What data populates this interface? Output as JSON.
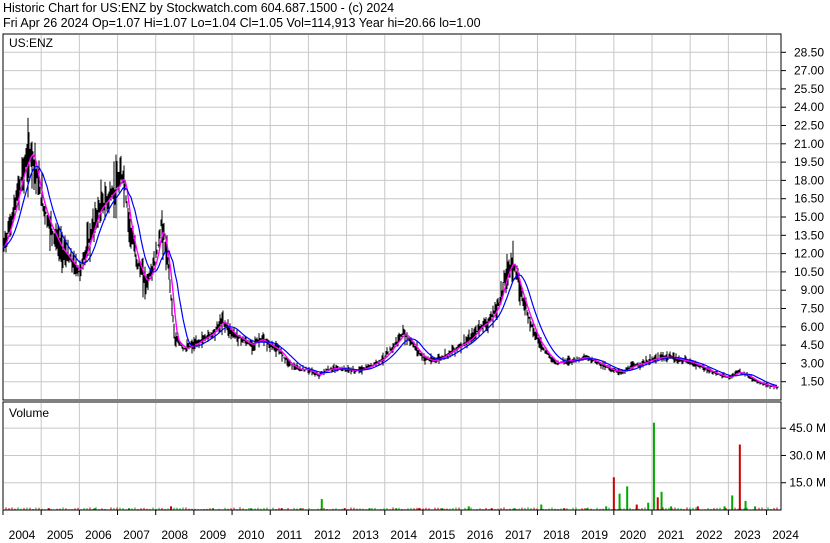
{
  "header": {
    "line1": "Historic Chart for US:ENZ by Stockwatch.com 604.687.1500 - (c) 2024",
    "line2": "Fri Apr 26 2024   Op=1.07  Hi=1.07  Lo=1.04  Cl=1.05  Vol=114,913  Year hi=20.66  lo=1.00"
  },
  "colors": {
    "grid": "#c8c8c8",
    "price_bar": "#000000",
    "ma_short": "#ff00ff",
    "ma_long": "#0000ff",
    "vol_up": "#00aa00",
    "vol_down": "#cc0000"
  },
  "chart_data": [
    {
      "type": "line",
      "title": "US:ENZ",
      "y_scale": "linear",
      "ylim": [
        0,
        30
      ],
      "yticks": [
        "28.50",
        "27.00",
        "25.50",
        "24.00",
        "22.50",
        "21.00",
        "19.50",
        "18.00",
        "16.50",
        "15.00",
        "13.50",
        "12.00",
        "10.50",
        "9.00",
        "7.50",
        "6.00",
        "4.50",
        "3.00",
        "1.50"
      ],
      "x_ticks": [
        "2004",
        "2005",
        "2006",
        "2007",
        "2008",
        "2009",
        "2010",
        "2011",
        "2012",
        "2013",
        "2014",
        "2015",
        "2016",
        "2017",
        "2018",
        "2019",
        "2020",
        "2021",
        "2022",
        "2023",
        "2024"
      ],
      "x": [
        2004.0,
        2004.25,
        2004.5,
        2004.75,
        2005.0,
        2005.2,
        2005.35,
        2005.5,
        2005.75,
        2006.0,
        2006.25,
        2006.5,
        2006.75,
        2007.0,
        2007.15,
        2007.3,
        2007.5,
        2007.75,
        2008.0,
        2008.15,
        2008.35,
        2008.5,
        2008.75,
        2009.0,
        2009.25,
        2009.5,
        2009.75,
        2010.0,
        2010.25,
        2010.5,
        2010.75,
        2011.0,
        2011.25,
        2011.5,
        2011.75,
        2012.0,
        2012.25,
        2012.5,
        2012.75,
        2013.0,
        2013.25,
        2013.5,
        2013.75,
        2014.0,
        2014.25,
        2014.5,
        2014.75,
        2015.0,
        2015.25,
        2015.5,
        2015.75,
        2016.0,
        2016.25,
        2016.5,
        2016.75,
        2017.0,
        2017.15,
        2017.35,
        2017.5,
        2017.75,
        2018.0,
        2018.25,
        2018.5,
        2018.75,
        2019.0,
        2019.25,
        2019.5,
        2019.75,
        2020.0,
        2020.25,
        2020.5,
        2020.75,
        2021.0,
        2021.25,
        2021.5,
        2021.75,
        2022.0,
        2022.25,
        2022.5,
        2022.75,
        2023.0,
        2023.25,
        2023.5,
        2023.75,
        2024.0,
        2024.3
      ],
      "series": [
        {
          "values": [
            12.5,
            15.0,
            18.5,
            20.5,
            16.5,
            14.5,
            13.5,
            12.5,
            11.5,
            10.5,
            13.0,
            15.5,
            16.5,
            17.5,
            18.5,
            14.5,
            11.5,
            9.5,
            11.5,
            14.5,
            10.5,
            5.0,
            4.2,
            4.5,
            5.0,
            5.5,
            6.5,
            5.5,
            5.0,
            4.5,
            5.0,
            4.5,
            4.0,
            3.0,
            2.5,
            2.5,
            2.0,
            2.5,
            2.6,
            2.5,
            2.4,
            2.6,
            3.0,
            3.5,
            4.5,
            5.5,
            4.5,
            3.5,
            3.2,
            3.5,
            4.0,
            4.5,
            5.0,
            6.0,
            6.5,
            8.0,
            10.0,
            11.5,
            9.5,
            7.0,
            5.0,
            3.8,
            3.0,
            3.2,
            3.3,
            3.5,
            3.2,
            2.8,
            2.4,
            2.3,
            2.8,
            3.0,
            3.3,
            3.5,
            3.5,
            3.3,
            3.1,
            2.8,
            2.4,
            2.1,
            1.8,
            2.3,
            2.0,
            1.5,
            1.2,
            1.05
          ]
        }
      ]
    },
    {
      "type": "bar",
      "title": "Volume",
      "ylim": [
        0,
        55
      ],
      "yticks": [
        "45.0 M",
        "30.0 M",
        "15.0 M"
      ],
      "x": [
        2005.2,
        2006.4,
        2007.3,
        2008.4,
        2009.5,
        2010.5,
        2011.3,
        2011.8,
        2012.35,
        2012.95,
        2013.6,
        2014.3,
        2014.9,
        2015.5,
        2016.2,
        2016.8,
        2017.4,
        2018.1,
        2018.7,
        2019.3,
        2019.8,
        2020.0,
        2020.15,
        2020.35,
        2020.6,
        2020.9,
        2021.05,
        2021.15,
        2021.25,
        2021.5,
        2022.2,
        2022.9,
        2023.1,
        2023.3,
        2023.45,
        2023.7
      ],
      "values": [
        1,
        1,
        1,
        2,
        1,
        1,
        1,
        1,
        6,
        1,
        1,
        1,
        1,
        1,
        2,
        1,
        1,
        3,
        1,
        1,
        2,
        18,
        9,
        13,
        3,
        4,
        48,
        7,
        10,
        2,
        2,
        2,
        8,
        36,
        5,
        2
      ]
    }
  ]
}
